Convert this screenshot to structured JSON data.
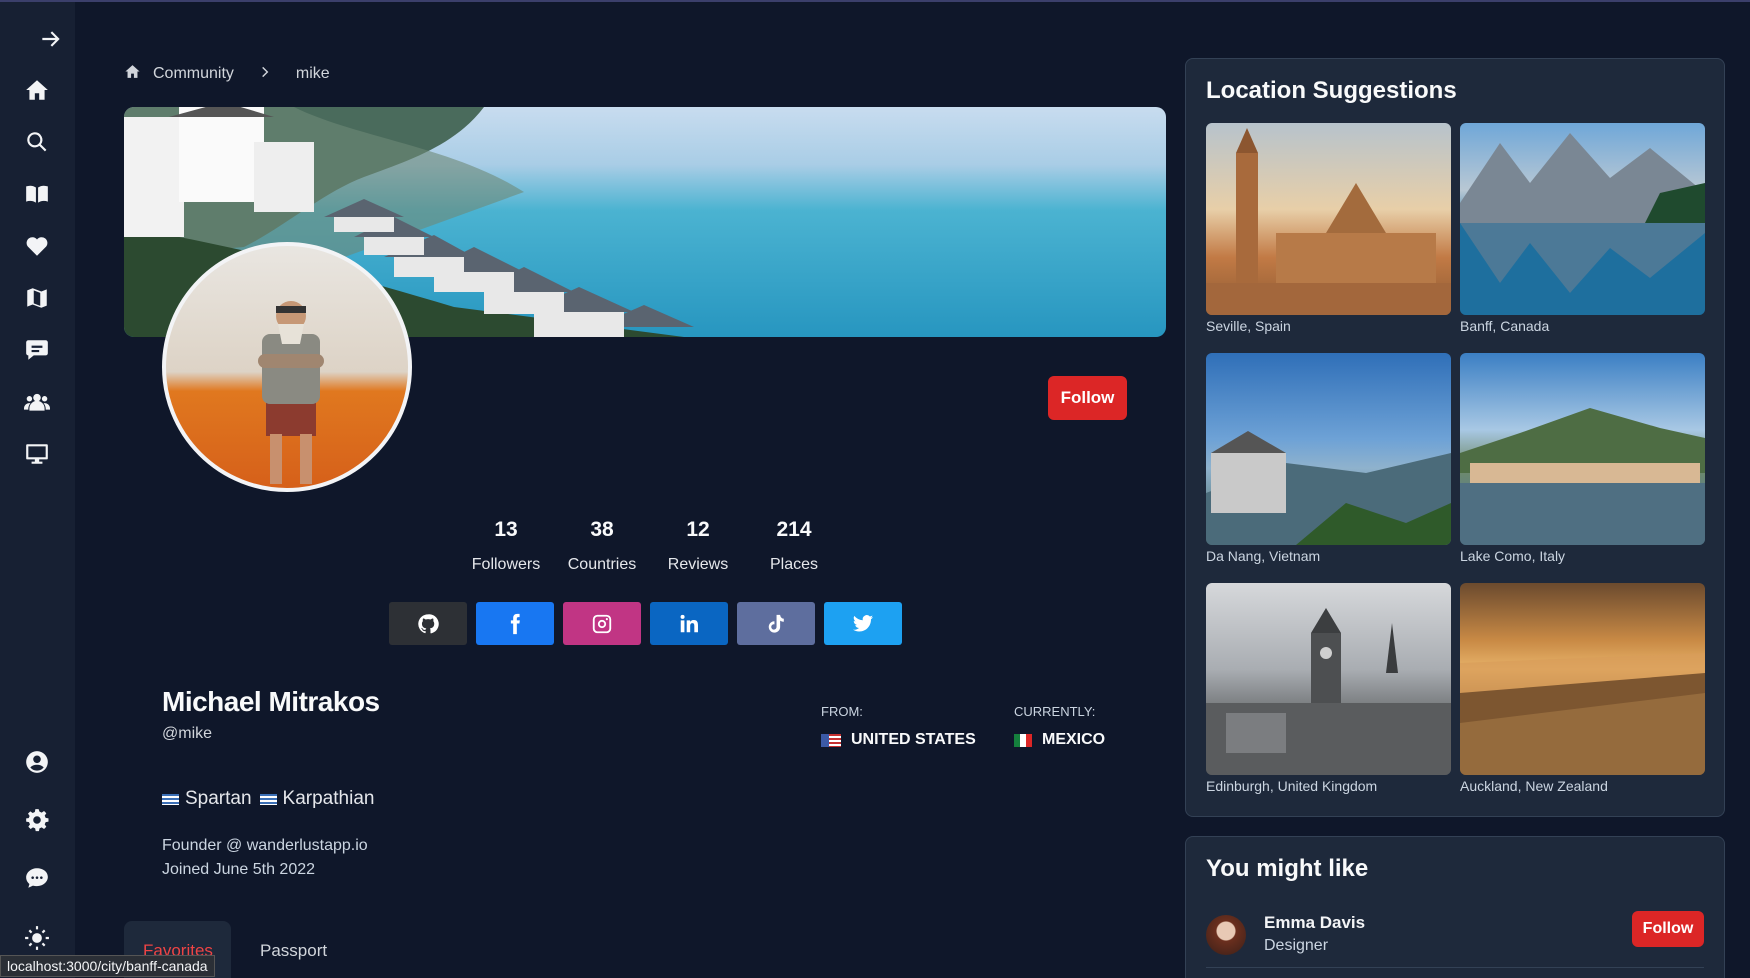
{
  "breadcrumb": {
    "home": "Community",
    "current": "mike"
  },
  "profile": {
    "name": "Michael Mitrakos",
    "handle": "@mike",
    "tag1": "Spartan",
    "tag2": "Karpathian",
    "bio_line1": "Founder @ wanderlustapp.io",
    "bio_line2": "Joined June 5th 2022",
    "follow_label": "Follow"
  },
  "stats": [
    {
      "value": "13",
      "label": "Followers"
    },
    {
      "value": "38",
      "label": "Countries"
    },
    {
      "value": "12",
      "label": "Reviews"
    },
    {
      "value": "214",
      "label": "Places"
    }
  ],
  "social": [
    {
      "icon": "github-icon",
      "color": "#2d3035"
    },
    {
      "icon": "facebook-icon",
      "color": "#1877f2"
    },
    {
      "icon": "instagram-icon",
      "color": "#c13584"
    },
    {
      "icon": "linkedin-icon",
      "color": "#0a66c2"
    },
    {
      "icon": "tiktok-icon",
      "color": "#69c9d0"
    },
    {
      "icon": "twitter-icon",
      "color": "#1da1f2"
    }
  ],
  "origin": {
    "from_label": "FROM:",
    "from_value": "UNITED STATES",
    "current_label": "CURRENTLY:",
    "current_value": "MEXICO"
  },
  "tabs": {
    "favorites": "Favorites",
    "passport": "Passport"
  },
  "status_url": "localhost:3000/city/banff-canada",
  "location_suggestions": {
    "title": "Location Suggestions",
    "items": [
      {
        "name": "Seville, Spain"
      },
      {
        "name": "Banff, Canada"
      },
      {
        "name": "Da Nang, Vietnam"
      },
      {
        "name": "Lake Como, Italy"
      },
      {
        "name": "Edinburgh, United Kingdom"
      },
      {
        "name": "Auckland, New Zealand"
      }
    ]
  },
  "you_might_like": {
    "title": "You might like",
    "user": {
      "name": "Emma Davis",
      "role": "Designer",
      "follow_label": "Follow"
    }
  },
  "colors": {
    "accent": "#dc2626",
    "background": "#0f172a",
    "panel": "#1e293b"
  }
}
